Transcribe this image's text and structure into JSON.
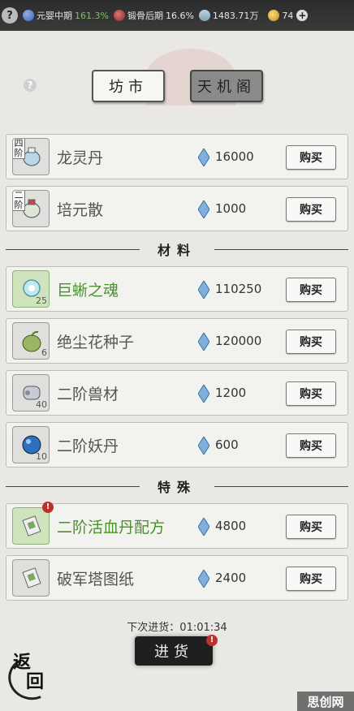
{
  "status_bar": {
    "help": "?",
    "stage_label": "元婴中期",
    "stage_percent": "161.3%",
    "body_label": "锻骨后期",
    "body_percent": "16.6%",
    "spirit_stones": "1483.71万",
    "gold": "74",
    "add": "+"
  },
  "tabs": [
    {
      "label": "坊市",
      "active": true
    },
    {
      "label": "天机阁",
      "active": false
    }
  ],
  "items": [
    {
      "tier": "四阶",
      "name": "龙灵丹",
      "price": "16000",
      "buy": "购买",
      "icon": "pill-bottle-icon",
      "qty": ""
    },
    {
      "tier": "二阶",
      "name": "培元散",
      "price": "1000",
      "buy": "购买",
      "icon": "pill-bottle-icon",
      "qty": ""
    }
  ],
  "sections": {
    "materials": "材料",
    "special": "特殊"
  },
  "materials": [
    {
      "name": "巨蜥之魂",
      "price": "110250",
      "buy": "购买",
      "icon": "soul-icon",
      "qty": "25",
      "highlight": true
    },
    {
      "name": "绝尘花种子",
      "price": "120000",
      "buy": "购买",
      "icon": "seed-icon",
      "qty": "6",
      "highlight": false
    },
    {
      "name": "二阶兽材",
      "price": "1200",
      "buy": "购买",
      "icon": "beast-material-icon",
      "qty": "40",
      "highlight": false
    },
    {
      "name": "二阶妖丹",
      "price": "600",
      "buy": "购买",
      "icon": "demon-core-icon",
      "qty": "10",
      "highlight": false
    }
  ],
  "special": [
    {
      "name": "二阶活血丹配方",
      "price": "4800",
      "buy": "购买",
      "icon": "scroll-icon",
      "qty": "",
      "highlight": true,
      "alert": "!"
    },
    {
      "name": "破军塔图纸",
      "price": "2400",
      "buy": "购买",
      "icon": "scroll-icon",
      "qty": "",
      "highlight": false
    }
  ],
  "restock": {
    "label": "下次进货：01:01:34",
    "button": "进货",
    "alert": "!"
  },
  "back": {
    "c1": "返",
    "c2": "回"
  },
  "corner_mark": "思创网",
  "colors": {
    "highlight_text": "#4b8f2f",
    "alert": "#c0302a",
    "stone": "#6a9fd6"
  }
}
